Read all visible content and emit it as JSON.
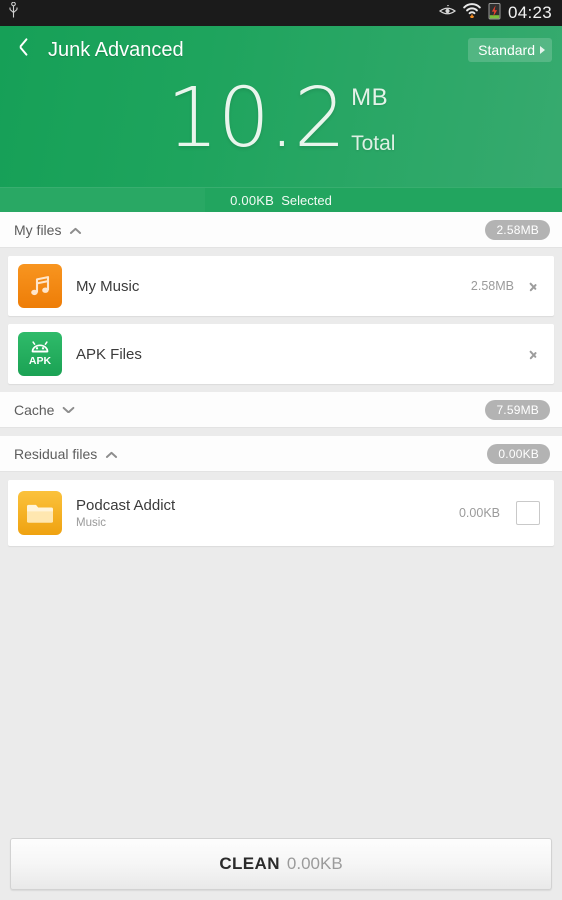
{
  "statusbar": {
    "usb_icon": "usb-icon",
    "eye_icon": "eye-icon",
    "wifi_icon": "wifi-icon",
    "battery_icon": "battery-charging-icon",
    "clock": "04:23"
  },
  "header": {
    "back_icon": "back-chevron-icon",
    "title": "Junk Advanced",
    "mode_button_label": "Standard",
    "mode_button_icon": "chevron-right-icon",
    "total_number": "10.2",
    "total_unit": "MB",
    "total_label": "Total",
    "selected_amount": "0.00KB",
    "selected_word": "Selected",
    "bg_green_start": "#16a057",
    "bg_green_end": "#37aa6f",
    "selected_bar_color": "#22a55f"
  },
  "sections": [
    {
      "name": "my-files",
      "title": "My files",
      "chevron": "chevron-up-icon",
      "expanded": true,
      "badge": "2.58MB",
      "rows": [
        {
          "name": "my-music",
          "icon": "music-note-icon",
          "icon_color": "#f28a12",
          "title": "My Music",
          "subtitle": "",
          "size": "2.58MB",
          "accessory": "chevron-right-icon"
        },
        {
          "name": "apk-files",
          "icon": "android-apk-icon",
          "icon_color": "#22ab5f",
          "icon_text": "APK",
          "title": "APK Files",
          "subtitle": "",
          "size": "",
          "accessory": "chevron-right-icon"
        }
      ]
    },
    {
      "name": "cache",
      "title": "Cache",
      "chevron": "chevron-down-icon",
      "expanded": false,
      "badge": "7.59MB",
      "rows": []
    },
    {
      "name": "residual-files",
      "title": "Residual files",
      "chevron": "chevron-up-icon",
      "expanded": true,
      "badge": "0.00KB",
      "rows": [
        {
          "name": "podcast-addict",
          "icon": "folder-icon",
          "icon_color": "#f4b01f",
          "title": "Podcast Addict",
          "subtitle": "Music",
          "size": "0.00KB",
          "accessory": "checkbox-unchecked"
        }
      ]
    }
  ],
  "footer": {
    "clean_label": "CLEAN",
    "clean_size": "0.00KB"
  },
  "colors": {
    "page_bg": "#ebebeb",
    "card_bg": "#ffffff",
    "badge_bg": "#b3b3b3",
    "statusbar_bg": "#1b1b1b"
  }
}
